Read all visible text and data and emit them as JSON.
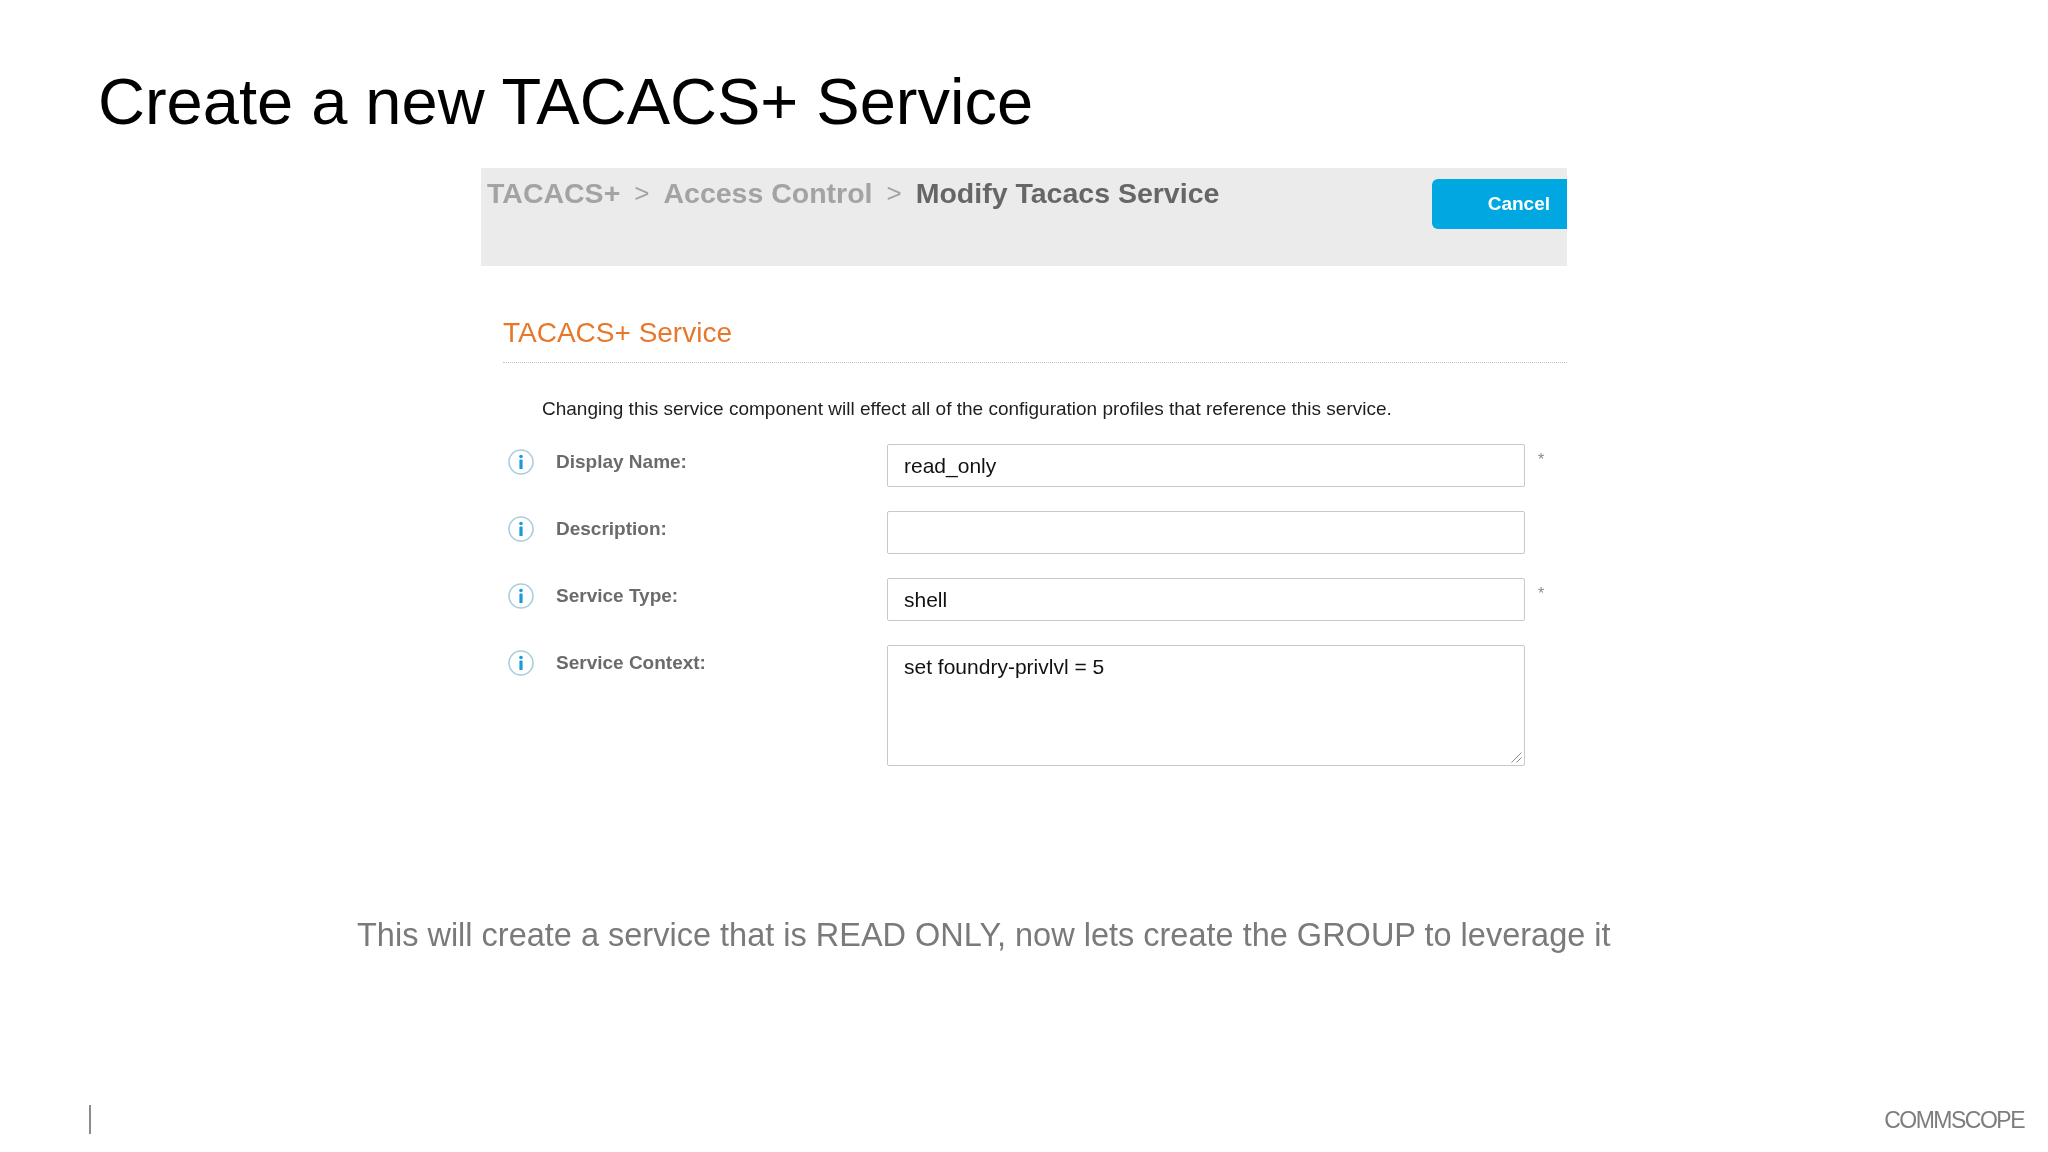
{
  "slide": {
    "title": "Create a new TACACS+ Service"
  },
  "screenshot": {
    "breadcrumb": [
      {
        "label": "TACACS+",
        "current": false,
        "separator": ">"
      },
      {
        "label": "Access Control",
        "current": false,
        "separator": ">"
      },
      {
        "label": "Modify Tacacs Service",
        "current": true
      }
    ],
    "cancel_button": "Cancel",
    "section_title": "TACACS+ Service",
    "notice": "Changing this service component will effect all of the configuration profiles that reference this service.",
    "fields": [
      {
        "kind": "input",
        "label": "Display Name:",
        "value": "read_only",
        "required_mark": "*"
      },
      {
        "kind": "input",
        "label": "Description:"
      },
      {
        "kind": "input",
        "label": "Service Type:",
        "value": "shell",
        "required_mark": "*"
      },
      {
        "kind": "textarea",
        "label": "Service Context:",
        "value": "set foundry-privlvl = 5"
      }
    ]
  },
  "caption": "This will create a service that is READ ONLY, now lets create the GROUP to leverage it",
  "footer": {
    "logo": "COMMSCOPE"
  }
}
